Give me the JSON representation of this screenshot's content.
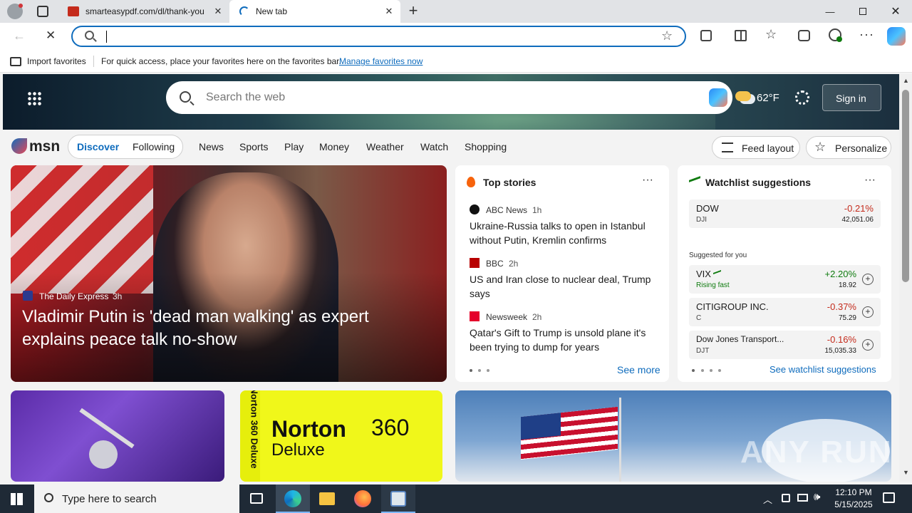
{
  "browser": {
    "tabs": [
      {
        "label": "smarteasypdf.com/dl/thank-you"
      },
      {
        "label": "New tab"
      }
    ],
    "address_bar": {
      "value": "",
      "placeholder": ""
    },
    "favorites_bar": {
      "import_label": "Import favorites",
      "hint_text": "For quick access, place your favorites here on the favorites bar.",
      "manage_link": "Manage favorites now"
    }
  },
  "msn": {
    "search_placeholder": "Search the web",
    "weather_temp": "62°F",
    "sign_in_label": "Sign in",
    "logo_text": "msn",
    "nav": {
      "discover": "Discover",
      "following": "Following",
      "links": [
        "News",
        "Sports",
        "Play",
        "Money",
        "Weather",
        "Watch",
        "Shopping"
      ],
      "feed_layout": "Feed layout",
      "personalize": "Personalize"
    },
    "hero": {
      "source": "The Daily Express",
      "age": "3h",
      "title": "Vladimir Putin is 'dead man walking' as expert explains peace talk no-show"
    },
    "top_stories": {
      "heading": "Top stories",
      "items": [
        {
          "source": "ABC News",
          "age": "1h",
          "title": "Ukraine-Russia talks to open in Istanbul without Putin, Kremlin confirms"
        },
        {
          "source": "BBC",
          "age": "2h",
          "title": "US and Iran close to nuclear deal, Trump says"
        },
        {
          "source": "Newsweek",
          "age": "2h",
          "title": "Qatar's Gift to Trump is unsold plane it's been trying to dump for years"
        }
      ],
      "see_more": "See more"
    },
    "watchlist": {
      "heading": "Watchlist suggestions",
      "primary": {
        "name": "DOW",
        "ticker": "DJI",
        "change": "-0.21%",
        "price": "42,051.06"
      },
      "suggested_label": "Suggested for you",
      "suggested": [
        {
          "name": "VIX",
          "ticker": "Rising fast",
          "change": "+2.20%",
          "price": "18.92"
        },
        {
          "name": "CITIGROUP INC.",
          "ticker": "C",
          "change": "-0.37%",
          "price": "75.29"
        },
        {
          "name": "Dow Jones Transport...",
          "ticker": "DJT",
          "change": "-0.16%",
          "price": "15,035.33"
        }
      ],
      "see_link": "See watchlist suggestions"
    },
    "promo": {
      "brand": "Norton",
      "product": "360",
      "edition": "Deluxe",
      "side_text": "Norton 360 Deluxe"
    },
    "watermark": "ANY RUN"
  },
  "taskbar": {
    "search_placeholder": "Type here to search",
    "time": "12:10 PM",
    "date": "5/15/2025"
  },
  "colors": {
    "accent": "#0f6cbd",
    "negative": "#c42b1c",
    "positive": "#0f7b0f",
    "taskbar": "#1f2a36"
  }
}
